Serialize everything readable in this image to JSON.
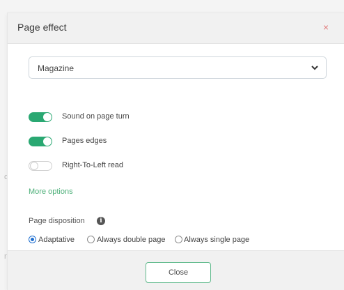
{
  "background": {
    "left_fragments": [
      "o",
      "n"
    ]
  },
  "dialog": {
    "title": "Page effect",
    "close_icon": "×"
  },
  "effect_select": {
    "value": "Magazine"
  },
  "toggles": [
    {
      "label": "Sound on page turn",
      "on": true
    },
    {
      "label": "Pages edges",
      "on": true
    },
    {
      "label": "Right-To-Left read",
      "on": false
    }
  ],
  "more_options": "More options",
  "page_disposition": {
    "label": "Page disposition",
    "info_icon": "i",
    "options": [
      {
        "label": "Adaptative",
        "checked": true
      },
      {
        "label": "Always double page",
        "checked": false
      },
      {
        "label": "Always single page",
        "checked": false
      }
    ]
  },
  "footer": {
    "close_label": "Close"
  },
  "colors": {
    "accent_green": "#2aa872",
    "link_green": "#4caf78",
    "radio_blue": "#1f6fd0",
    "close_x_red": "#e07b7b"
  }
}
